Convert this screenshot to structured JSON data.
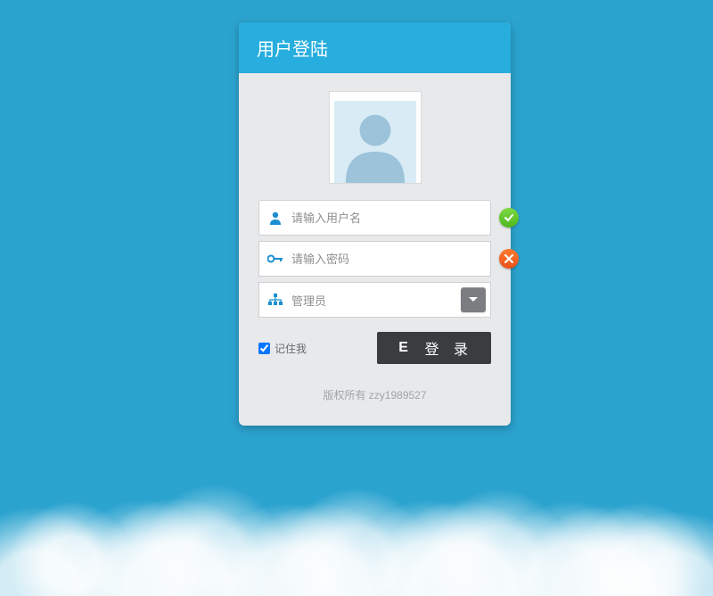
{
  "header": {
    "title": "用户登陆"
  },
  "form": {
    "username": {
      "placeholder": "请输入用户名",
      "value": "",
      "status": "ok"
    },
    "password": {
      "placeholder": "请输入密码",
      "value": "",
      "status": "error"
    },
    "role": {
      "selected": "管理员"
    },
    "remember": {
      "label": "记住我",
      "checked": true
    },
    "submit": {
      "label": "登 录",
      "icon_glyph": "E"
    }
  },
  "footer": {
    "copyright": "版权所有 zzy1989527"
  },
  "colors": {
    "bg": "#2ba3cf",
    "header_bg": "#27aede",
    "panel_bg": "#e8e9eb",
    "btn_bg": "#3a3c3f",
    "status_ok": "#5cc52b",
    "status_err": "#f05a1f"
  }
}
